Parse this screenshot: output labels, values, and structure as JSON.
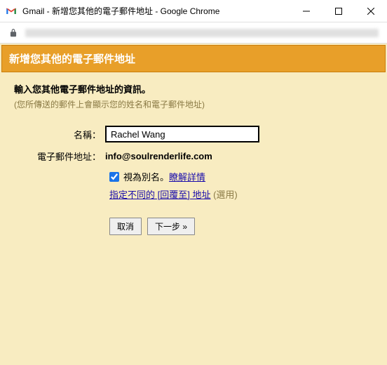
{
  "window": {
    "title": "Gmail - 新增您其他的電子郵件地址 - Google Chrome"
  },
  "header": {
    "title": "新增您其他的電子郵件地址"
  },
  "intro": {
    "title": "輸入您其他電子郵件地址的資訊。",
    "subtitle": "(您所傳送的郵件上會顯示您的姓名和電子郵件地址)"
  },
  "form": {
    "name_label": "名稱：",
    "name_value": "Rachel Wang",
    "email_label": "電子郵件地址：",
    "email_value": "info@soulrenderlife.com",
    "alias_label": "視為別名。",
    "alias_link": "瞭解詳情",
    "reply_link": "指定不同的 [回覆至] 地址",
    "reply_optional": " (選用)"
  },
  "buttons": {
    "cancel": "取消",
    "next": "下一步 »"
  }
}
